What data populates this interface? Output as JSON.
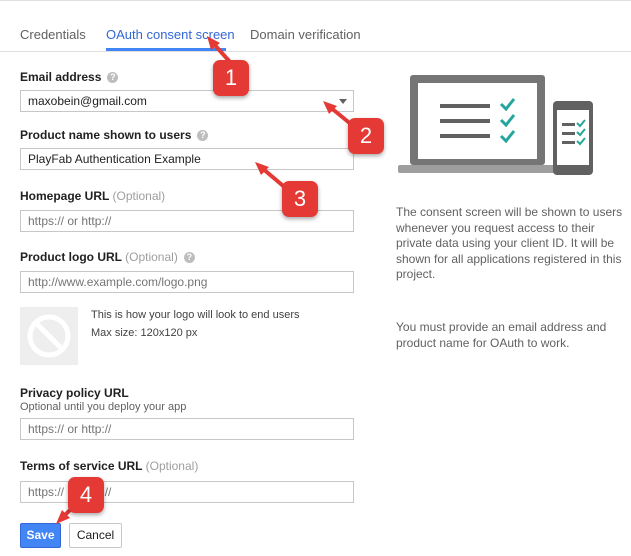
{
  "tabs": [
    {
      "label": "Credentials"
    },
    {
      "label": "OAuth consent screen"
    },
    {
      "label": "Domain verification"
    }
  ],
  "form": {
    "email_label": "Email address",
    "email_value": "maxobein@gmail.com",
    "product_label": "Product name shown to users",
    "product_value": "PlayFab Authentication Example",
    "homepage_label": "Homepage URL",
    "homepage_optional": "(Optional)",
    "homepage_placeholder": "https:// or http://",
    "logo_label": "Product logo URL",
    "logo_optional": "(Optional)",
    "logo_placeholder": "http://www.example.com/logo.png",
    "logo_note_line1": "This is how your logo will look to end users",
    "logo_note_line2": "Max size: 120x120 px",
    "privacy_label": "Privacy policy URL",
    "privacy_sub": "Optional until you deploy your app",
    "privacy_placeholder": "https:// or http://",
    "tos_label": "Terms of service URL",
    "tos_optional": "(Optional)",
    "tos_placeholder": "https:// or http://",
    "help_icon": "?"
  },
  "buttons": {
    "save": "Save",
    "cancel": "Cancel"
  },
  "side": {
    "para1": "The consent screen will be shown to users whenever you request access to their private data using your client ID. It will be shown for all applications registered in this project.",
    "para2": "You must provide an email address and product name for OAuth to work."
  },
  "callouts": [
    "1",
    "2",
    "3",
    "4"
  ],
  "colors": {
    "accent": "#4285f4",
    "callout": "#e53935",
    "check": "#26a69a"
  },
  "icons": [
    "help-icon",
    "dropdown-arrow-icon",
    "no-image-icon",
    "laptop-illustration",
    "phone-illustration"
  ]
}
